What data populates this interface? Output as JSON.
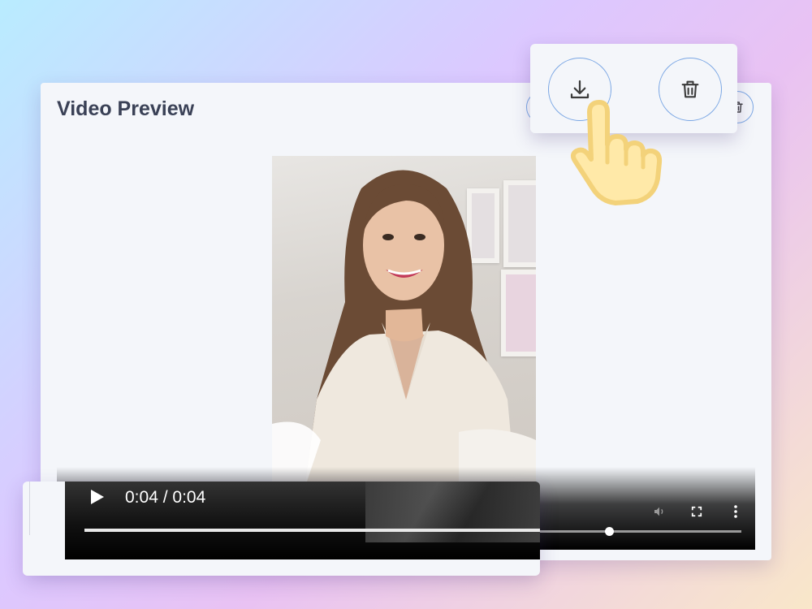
{
  "main": {
    "title": "Video Preview"
  },
  "player": {
    "time_current": "0:04",
    "time_separator": " / ",
    "time_total": "0:04",
    "progress": 0.8
  },
  "icons": {
    "download": "download-icon",
    "delete": "trash-icon",
    "play": "play-icon",
    "volume": "volume-icon",
    "fullscreen": "fullscreen-icon",
    "more": "more-vert-icon",
    "pointer": "pointer-hand-icon"
  },
  "colors": {
    "accent_border": "#7ba7e4",
    "hand_fill": "#ffe9a8",
    "hand_stroke": "#f3d27a"
  }
}
